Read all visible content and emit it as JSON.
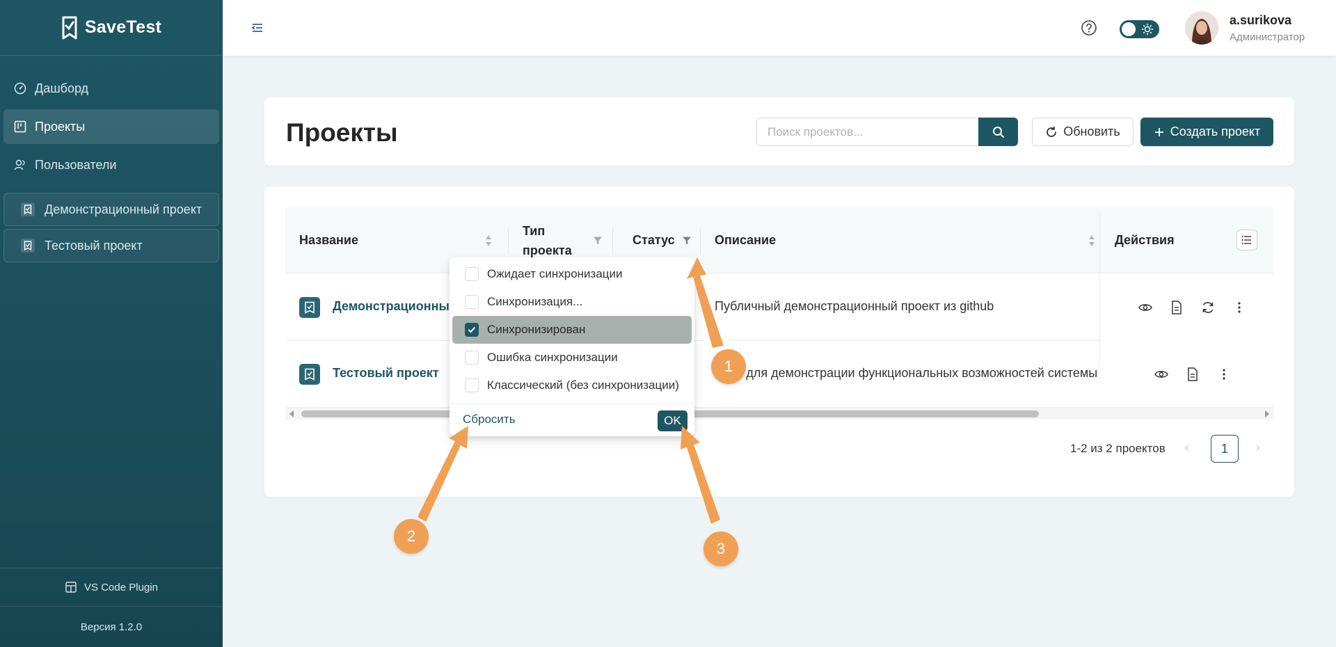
{
  "app": {
    "name": "SaveTest"
  },
  "sidebar": {
    "items": [
      {
        "label": "Дашборд",
        "icon": "dashboard-icon"
      },
      {
        "label": "Проекты",
        "icon": "projects-icon"
      },
      {
        "label": "Пользователи",
        "icon": "users-icon"
      }
    ],
    "projects": [
      {
        "label": "Демонстрационный проект"
      },
      {
        "label": "Тестовый проект"
      }
    ],
    "plugin_label": "VS Code Plugin",
    "version": "Версия 1.2.0"
  },
  "header": {
    "user_name": "a.surikova",
    "user_role": "Администратор"
  },
  "page": {
    "title": "Проекты",
    "search_placeholder": "Поиск проектов...",
    "refresh_label": "Обновить",
    "create_label": "Создать проект"
  },
  "table": {
    "columns": {
      "name": "Название",
      "type_line1": "Тип",
      "type_line2": "проекта",
      "status": "Статус",
      "description": "Описание",
      "actions": "Действия"
    },
    "rows": [
      {
        "name": "Демонстрационный",
        "description": "Публичный демонстрационный проект из github"
      },
      {
        "name": "Тестовый проект",
        "description": "кт для демонстрации функциональных возможностей системы"
      }
    ]
  },
  "status_filter": {
    "options": [
      {
        "label": "Ожидает синхронизации",
        "checked": false
      },
      {
        "label": "Синхронизация...",
        "checked": false
      },
      {
        "label": "Синхронизирован",
        "checked": true
      },
      {
        "label": "Ошибка синхронизации",
        "checked": false
      },
      {
        "label": "Классический (без синхронизации)",
        "checked": false
      }
    ],
    "reset_label": "Сбросить",
    "ok_label": "OK"
  },
  "pagination": {
    "summary": "1-2 из 2 проектов",
    "prev": "‹",
    "current_page": "1",
    "next": "›"
  },
  "annotations": [
    "1",
    "2",
    "3"
  ],
  "colors": {
    "primary": "#1e5664",
    "accent": "#f0a055"
  }
}
